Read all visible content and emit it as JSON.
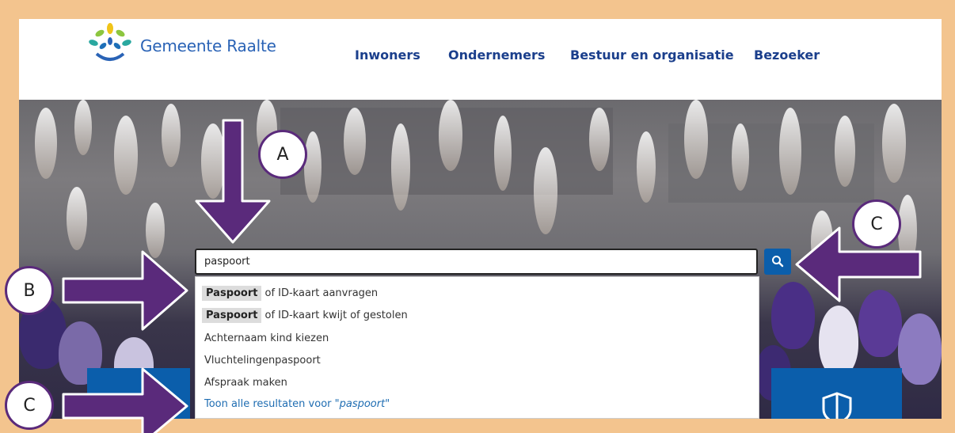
{
  "header": {
    "logo_text": "Gemeente Raalte",
    "nav": [
      "Inwoners",
      "Ondernemers",
      "Bestuur en organisatie",
      "Bezoeker"
    ]
  },
  "search": {
    "value": "paspoort",
    "button_icon": "search-icon"
  },
  "suggestions": [
    {
      "highlight": "Paspoort",
      "rest": "of ID-kaart aanvragen"
    },
    {
      "highlight": "Paspoort",
      "rest": "of ID-kaart kwijt of gestolen"
    },
    {
      "highlight": "",
      "rest": "Achternaam kind kiezen"
    },
    {
      "highlight": "",
      "rest": "Vluchtelingenpaspoort"
    },
    {
      "highlight": "",
      "rest": "Afspraak maken"
    }
  ],
  "show_all": {
    "prefix": "Toon alle resultaten voor \"",
    "term": "paspoort",
    "suffix": "\""
  },
  "annotations": {
    "a": "A",
    "b": "B",
    "c_top": "C",
    "c_bottom": "C"
  },
  "colors": {
    "frame": "#f3c48e",
    "brand_blue": "#0b5eab",
    "nav_blue": "#1b3f8c",
    "annotation_purple": "#5a2a7b"
  }
}
